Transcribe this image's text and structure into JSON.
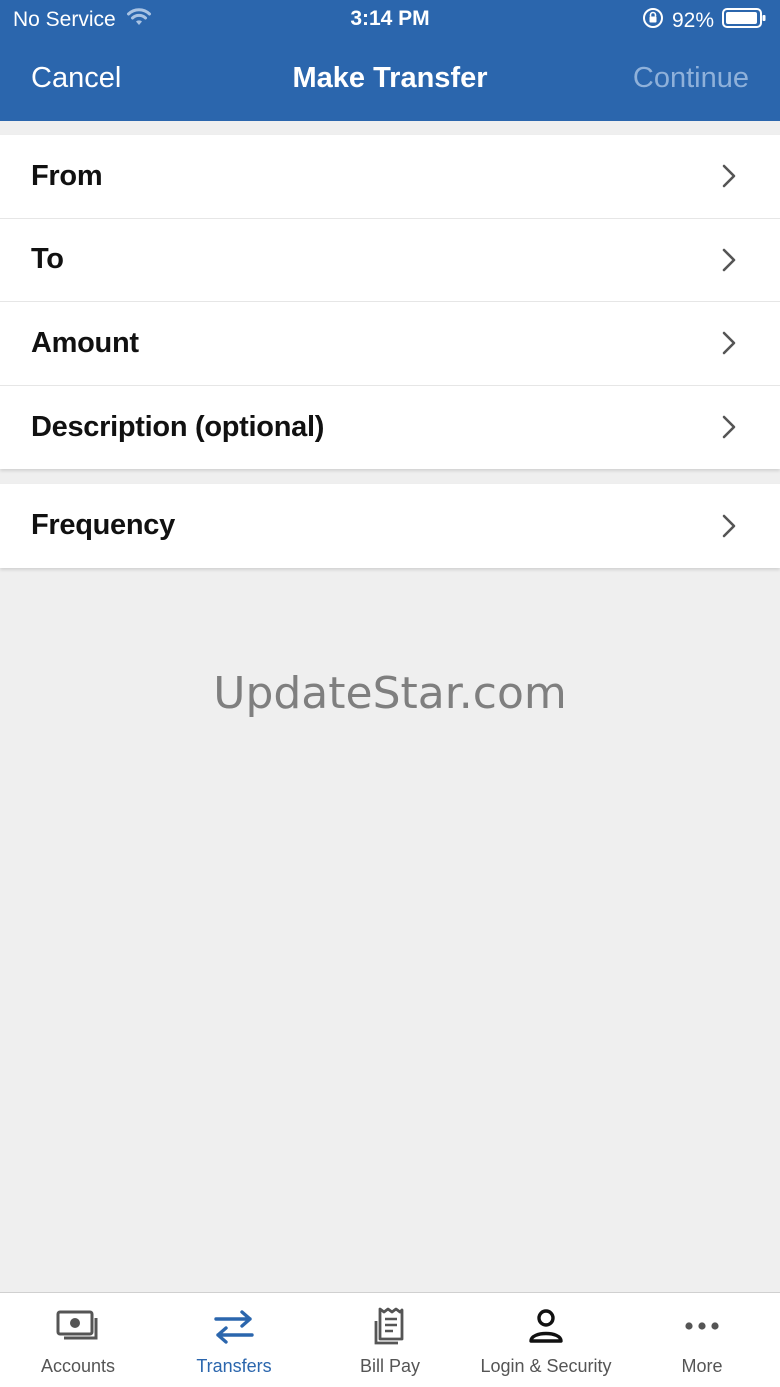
{
  "status_bar": {
    "carrier": "No Service",
    "time": "3:14 PM",
    "battery": "92%"
  },
  "header": {
    "cancel_label": "Cancel",
    "title": "Make Transfer",
    "continue_label": "Continue"
  },
  "form": {
    "rows": [
      {
        "label": "From"
      },
      {
        "label": "To"
      },
      {
        "label": "Amount"
      },
      {
        "label": "Description (optional)"
      }
    ],
    "frequency_label": "Frequency"
  },
  "watermark": "UpdateStar.com",
  "tabbar": {
    "tabs": [
      {
        "label": "Accounts",
        "icon": "cash-icon",
        "active": false
      },
      {
        "label": "Transfers",
        "icon": "transfer-arrows-icon",
        "active": true
      },
      {
        "label": "Bill Pay",
        "icon": "receipt-icon",
        "active": false
      },
      {
        "label": "Login & Security",
        "icon": "person-icon",
        "active": false
      },
      {
        "label": "More",
        "icon": "more-dots-icon",
        "active": false
      }
    ]
  },
  "colors": {
    "header_bg": "#2b66ad",
    "continue_disabled": "#8fb1da",
    "active_tab": "#2b66ad",
    "background": "#efefef"
  }
}
